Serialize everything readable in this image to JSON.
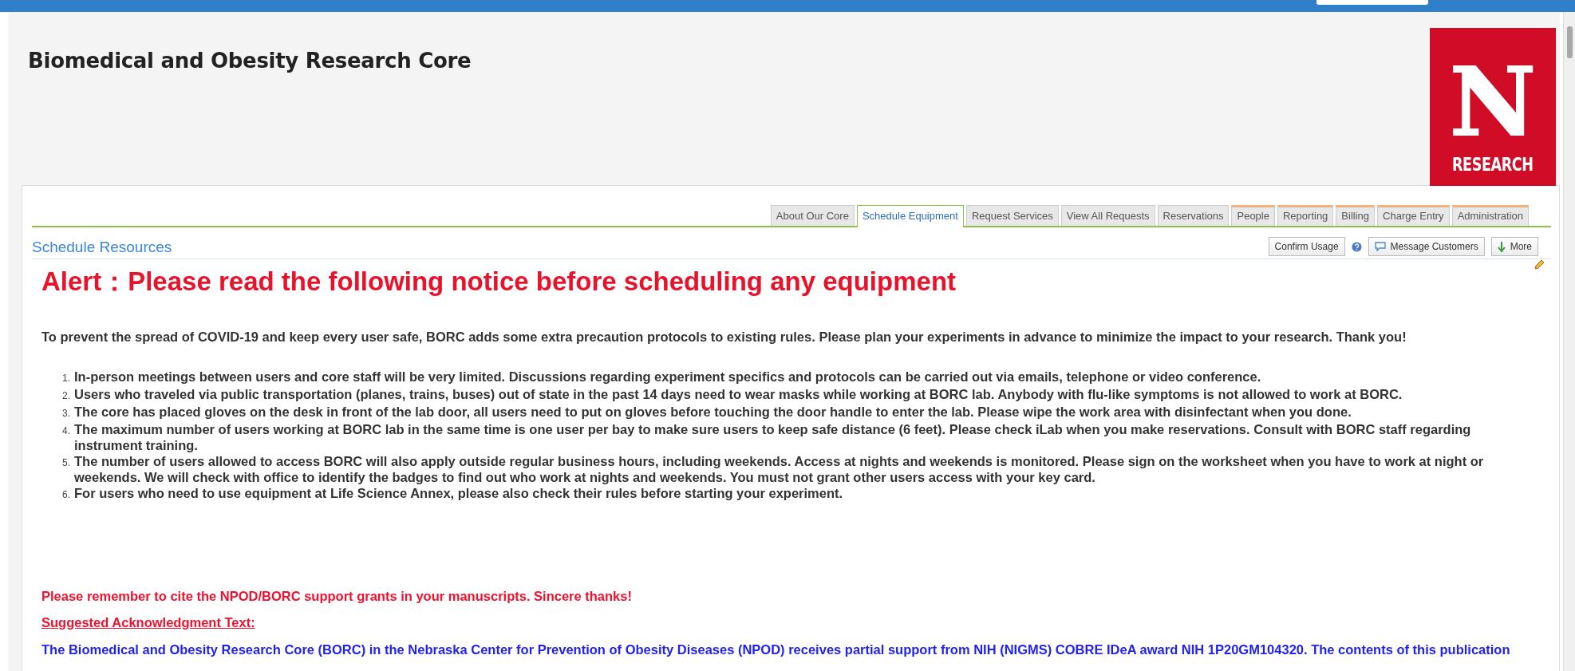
{
  "header": {
    "title": "Biomedical and Obesity Research Core",
    "logo": {
      "letter": "N",
      "caption": "RESEARCH"
    }
  },
  "tabs": [
    {
      "label": "About Our Core",
      "selected": false,
      "kind": "standard"
    },
    {
      "label": "Schedule Equipment",
      "selected": true,
      "kind": "standard"
    },
    {
      "label": "Request Services",
      "selected": false,
      "kind": "standard"
    },
    {
      "label": "View All Requests",
      "selected": false,
      "kind": "standard"
    },
    {
      "label": "Reservations",
      "selected": false,
      "kind": "standard"
    },
    {
      "label": "People",
      "selected": false,
      "kind": "staff"
    },
    {
      "label": "Reporting",
      "selected": false,
      "kind": "staff"
    },
    {
      "label": "Billing",
      "selected": false,
      "kind": "staff"
    },
    {
      "label": "Charge Entry",
      "selected": false,
      "kind": "staff"
    },
    {
      "label": "Administration",
      "selected": false,
      "kind": "staff"
    }
  ],
  "section": {
    "title": "Schedule Resources",
    "buttons": [
      {
        "label": "Confirm Usage",
        "kind": "plain"
      },
      {
        "kind": "help"
      },
      {
        "label": "Message Customers",
        "kind": "message"
      },
      {
        "label": "More",
        "kind": "more"
      }
    ]
  },
  "notice": {
    "alert": "Alert：Please read the following notice before scheduling any equipment",
    "intro": "To prevent the spread of COVID-19 and keep every user safe, BORC adds some extra precaution protocols to existing rules. Please plan your experiments in advance to minimize the impact to your research. Thank you!",
    "rules": [
      {
        "marker": "1.",
        "text": "In-person meetings between users and core staff will be very limited.  Discussions regarding experiment specifics and protocols can be carried out via emails, telephone or video conference."
      },
      {
        "marker": "2.",
        "text": "Users who traveled via public transportation (planes, trains, buses) out of state in the past 14 days need to wear masks while working at BORC lab. Anybody with flu-like symptoms is not allowed to work at BORC."
      },
      {
        "marker": "3.",
        "text": "The core has placed gloves on the desk in front of the lab door, all users need to put on gloves before touching the door handle to enter the lab. Please wipe the work area with disinfectant when you done."
      },
      {
        "marker": "4.",
        "text": "The maximum number of users working at BORC lab in the same time is one user per bay to make sure users to keep safe distance (6 feet).  Please check iLab when you make reservations. Consult with BORC staff regarding instrument training."
      },
      {
        "marker": "5.",
        "text": "The number of users allowed to access BORC will also apply outside regular business hours, including weekends. Access at nights and weekends is monitored. Please sign on the worksheet when you have to work at night or weekends. We will check with office to identify the badges to find out who work at nights and weekends. You must not grant other users access with your key card."
      },
      {
        "marker": "6.",
        "text": "For users who need to use equipment at Life Science Annex, please also check their rules before starting your experiment."
      }
    ],
    "cite": "Please remember to cite the NPOD/BORC support grants in your manuscripts. Sincere thanks!",
    "ack_heading": "Suggested Acknowledgment Text:",
    "ack": "The Biomedical and Obesity Research Core (BORC) in the Nebraska Center for Prevention of Obesity Diseases (NPOD) receives partial support from NIH (NIGMS) COBRE IDeA award NIH 1P20GM104320. The contents of this publication"
  }
}
